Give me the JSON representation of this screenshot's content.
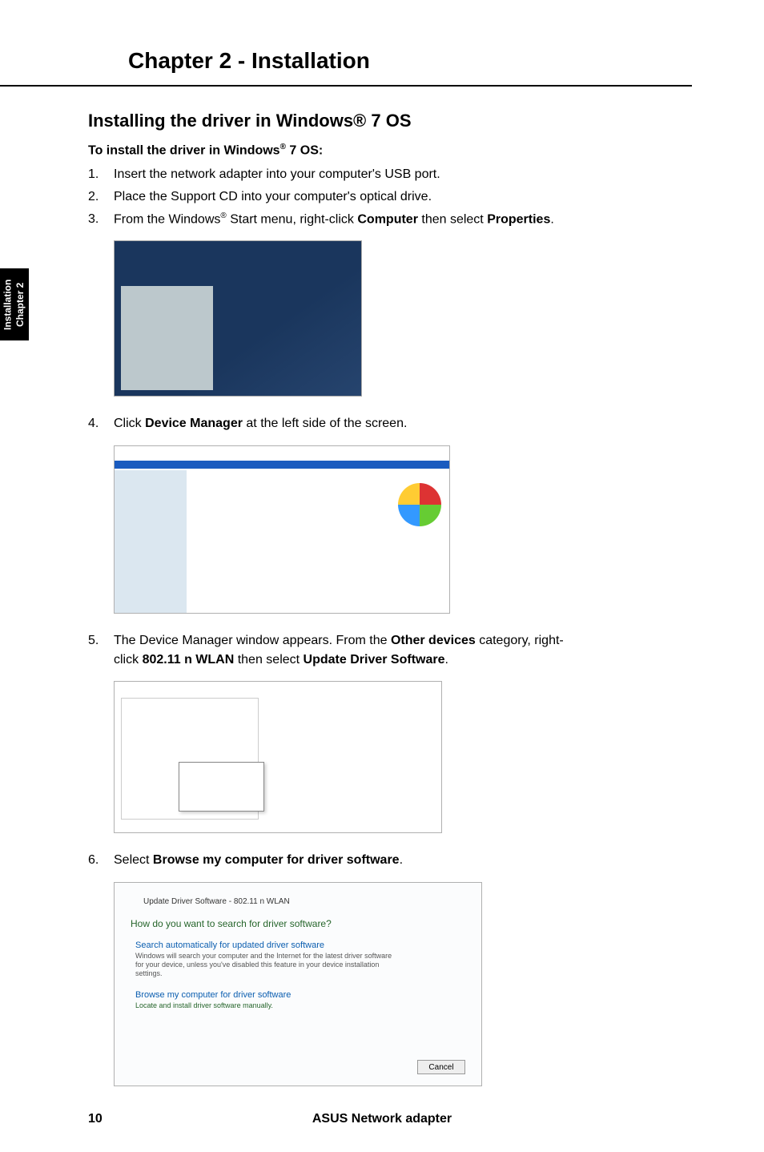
{
  "chapter_header": "Chapter 2 - Installation",
  "side_tab": {
    "line1": "Chapter 2",
    "line2": "Installation"
  },
  "section": {
    "title": "Installing the driver in Windows® 7 OS",
    "subtitle_pre": "To install the driver in Windows",
    "subtitle_sup": "®",
    "subtitle_post": " 7 OS:",
    "steps": {
      "s1": "Insert the network adapter into your computer's USB port.",
      "s2": "Place the Support CD into your computer's optical drive.",
      "s3_pre": "From the Windows",
      "s3_sup": "®",
      "s3_mid": " Start menu, right-click ",
      "s3_b1": "Computer",
      "s3_mid2": " then select ",
      "s3_b2": "Properties",
      "s3_post": ".",
      "s4_pre": "Click ",
      "s4_b1": "Device Manager",
      "s4_post": " at the left side of the screen.",
      "s5_pre": "The Device Manager window appears. From the ",
      "s5_b1": "Other devices",
      "s5_mid": " category, right-",
      "s5_line2_pre": "click ",
      "s5_b2": "802.11 n WLAN",
      "s5_mid2": " then select ",
      "s5_b3": "Update Driver Software",
      "s5_post": ".",
      "s6_pre": "Select ",
      "s6_b1": "Browse my computer for driver software",
      "s6_post": "."
    }
  },
  "img4": {
    "title": "Update Driver Software - 802.11 n WLAN",
    "question": "How do you want to search for driver software?",
    "opt1": "Search automatically for updated driver software",
    "opt1_desc1": "Windows will search your computer and the Internet for the latest driver software",
    "opt1_desc2": "for your device, unless you've disabled this feature in your device installation",
    "opt1_desc3": "settings.",
    "opt2": "Browse my computer for driver software",
    "opt2_desc": "Locate and install driver software manually.",
    "cancel": "Cancel"
  },
  "footer": {
    "page": "10",
    "title": "ASUS Network adapter"
  }
}
